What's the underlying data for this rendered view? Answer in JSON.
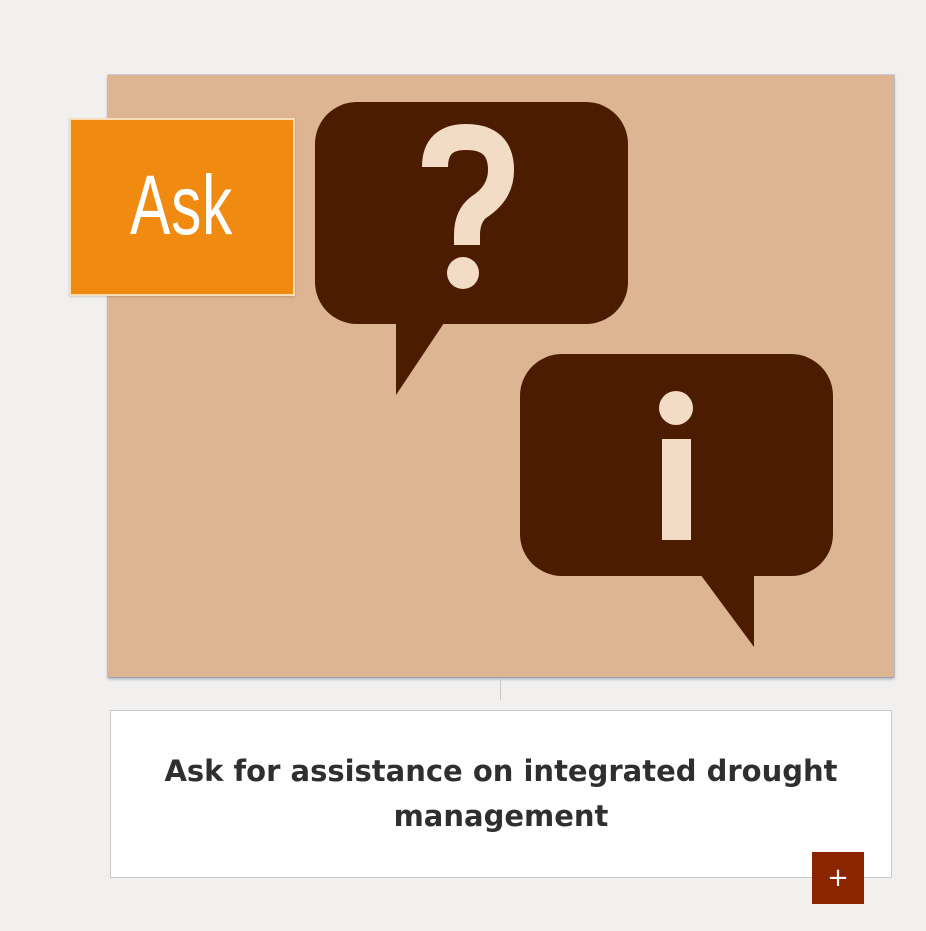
{
  "card": {
    "badge_label": "Ask",
    "title": "Ask for assistance on integrated drought management",
    "expand_label": "+",
    "icons": [
      "question-bubble-icon",
      "info-bubble-icon"
    ]
  },
  "colors": {
    "page_background": "#f1f0ee",
    "image_background": "#ddb592",
    "bubble": "#4b1c00",
    "bubble_glyph": "#f3dcc6",
    "badge": "#f08a10",
    "expand_button": "#8b2500",
    "title_text": "#2f2f2f"
  }
}
